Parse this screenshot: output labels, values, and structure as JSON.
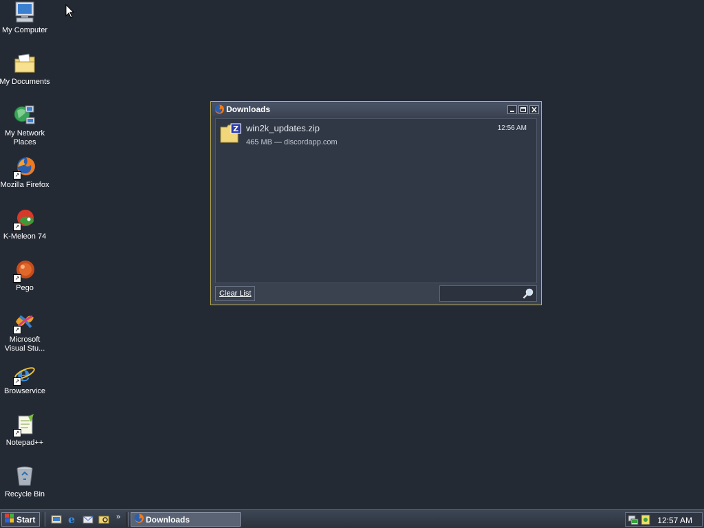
{
  "desktop": {
    "icons": [
      {
        "label": "My Computer"
      },
      {
        "label": "My Documents"
      },
      {
        "label": "My Network Places"
      },
      {
        "label": "Mozilla Firefox"
      },
      {
        "label": "K-Meleon 74"
      },
      {
        "label": "Pego"
      },
      {
        "label": "Microsoft Visual Stu..."
      },
      {
        "label": "Browservice"
      },
      {
        "label": "Notepad++"
      },
      {
        "label": "Recycle Bin"
      }
    ]
  },
  "downloads_window": {
    "title": "Downloads",
    "items": [
      {
        "filename": "win2k_updates.zip",
        "meta": "465 MB — discordapp.com",
        "time": "12:56 AM",
        "icon": "zip-folder-icon"
      }
    ],
    "clear_button_label": "Clear List",
    "search_value": ""
  },
  "taskbar": {
    "start_label": "Start",
    "quick_launch_more": "»",
    "active_task": "Downloads",
    "clock": "12:57 AM"
  },
  "colors": {
    "desktop_bg": "#242a34",
    "window_border": "#c8b85a",
    "window_bg": "#3a4250"
  }
}
